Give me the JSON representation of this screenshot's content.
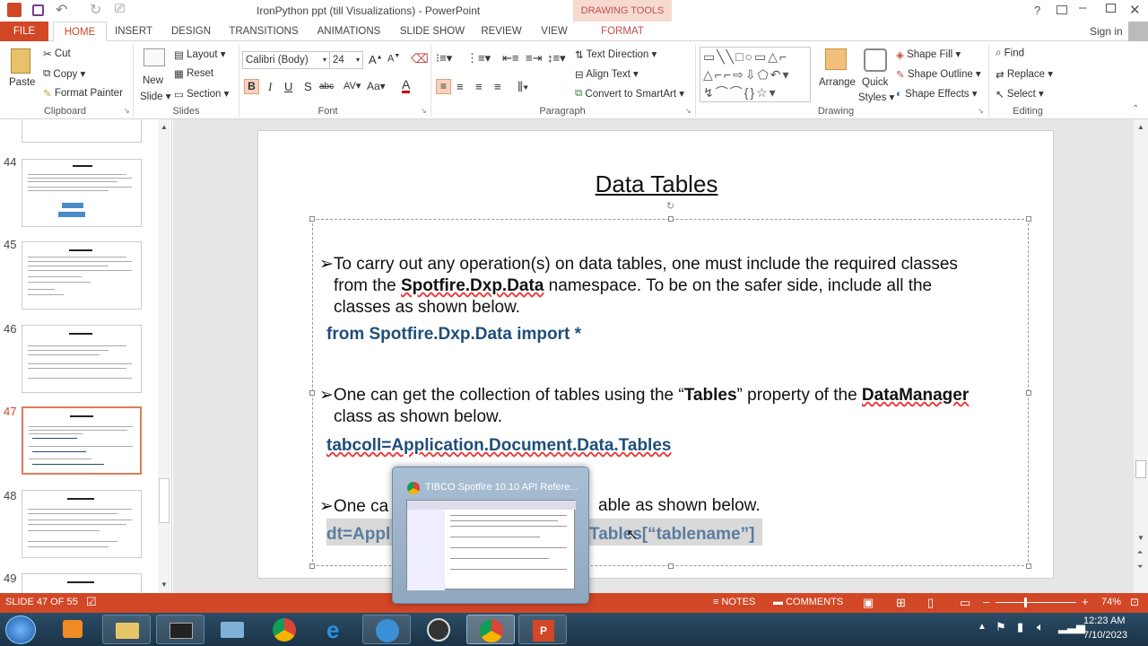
{
  "window": {
    "title": "IronPython ppt (till Visualizations) - PowerPoint",
    "contextual_tab": "DRAWING TOOLS",
    "help": "?",
    "sign_in": "Sign in"
  },
  "tabs": [
    "FILE",
    "HOME",
    "INSERT",
    "DESIGN",
    "TRANSITIONS",
    "ANIMATIONS",
    "SLIDE SHOW",
    "REVIEW",
    "VIEW",
    "FORMAT"
  ],
  "ribbon": {
    "clipboard": {
      "paste": "Paste",
      "cut": "Cut",
      "copy": "Copy",
      "format_painter": "Format Painter",
      "label": "Clipboard"
    },
    "slides": {
      "new_slide_1": "New",
      "new_slide_2": "Slide",
      "layout": "Layout",
      "reset": "Reset",
      "section": "Section",
      "label": "Slides"
    },
    "font": {
      "name": "Calibri (Body)",
      "size": "24",
      "label": "Font"
    },
    "paragraph": {
      "text_direction": "Text Direction",
      "align_text": "Align Text",
      "convert_smartart": "Convert to SmartArt",
      "label": "Paragraph"
    },
    "drawing": {
      "arrange": "Arrange",
      "quick_styles_1": "Quick",
      "quick_styles_2": "Styles",
      "shape_fill": "Shape Fill",
      "shape_outline": "Shape Outline",
      "shape_effects": "Shape Effects",
      "label": "Drawing"
    },
    "editing": {
      "find": "Find",
      "replace": "Replace",
      "select": "Select",
      "label": "Editing"
    }
  },
  "thumbnails": [
    {
      "num": "44"
    },
    {
      "num": "45"
    },
    {
      "num": "46"
    },
    {
      "num": "47"
    },
    {
      "num": "48"
    },
    {
      "num": "49"
    }
  ],
  "slide": {
    "title": "Data Tables",
    "bullet1_a": "To carry out any operation(s) on data tables, one must include the required classes",
    "bullet1_b_pre": "from the ",
    "bullet1_b_bold": "Spotfire.Dxp.Data",
    "bullet1_b_post": " namespace. To be on the safer side, include all the",
    "bullet1_c": "classes as shown below.",
    "code1": "from Spotfire.Dxp.Data import *",
    "bullet2_pre": "One can get the collection of tables using the “",
    "bullet2_bold1": "Tables",
    "bullet2_mid": "” property of the ",
    "bullet2_bold2": "DataManager",
    "bullet2_b": "class as shown below.",
    "code2": "tabcoll=Application.Document.Data.Tables",
    "bullet3_a": "One ca",
    "bullet3_b": "able as shown below.",
    "code3_a": "dt=Appl",
    "code3_b": "Tables[“tablename”]",
    "arrow": "➢"
  },
  "status": {
    "slide": "SLIDE 47 OF 55",
    "notes": "NOTES",
    "comments": "COMMENTS",
    "zoom": "74%"
  },
  "taskbar": {
    "time": "12:23 AM",
    "date": "7/10/2023",
    "preview_title": "TIBCO Spotfire 10.10 API Refere..."
  },
  "colors": {
    "accent": "#d24726",
    "code": "#1f4e79"
  }
}
